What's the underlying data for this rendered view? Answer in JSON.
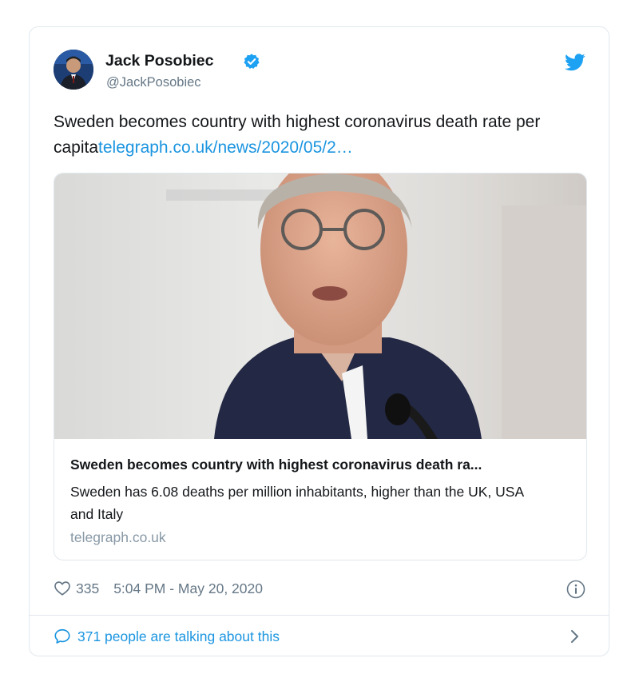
{
  "tweet": {
    "author_name": "Jack Posobiec",
    "handle": "@JackPosobiec",
    "text_plain": "Sweden becomes country with highest coronavirus death rate per capita",
    "text_link": "telegraph.co.uk/news/2020/05/2…",
    "likes": "335",
    "timestamp": "5:04 PM - May 20, 2020",
    "talking": "371 people are talking about this"
  },
  "card": {
    "title": "Sweden becomes country with highest coronavirus death ra...",
    "description": "Sweden has 6.08 deaths per million inhabitants, higher than the UK, USA and Italy",
    "domain": "telegraph.co.uk"
  },
  "icons": {
    "verified": "verified-badge-icon",
    "brand": "twitter-bird-icon",
    "like": "heart-icon",
    "info": "info-icon",
    "reply": "speech-bubble-icon",
    "chevron": "chevron-right-icon"
  },
  "colors": {
    "link": "#1b95e0",
    "verified": "#1da1f2",
    "muted": "#657786",
    "border": "#e1e8ed"
  }
}
